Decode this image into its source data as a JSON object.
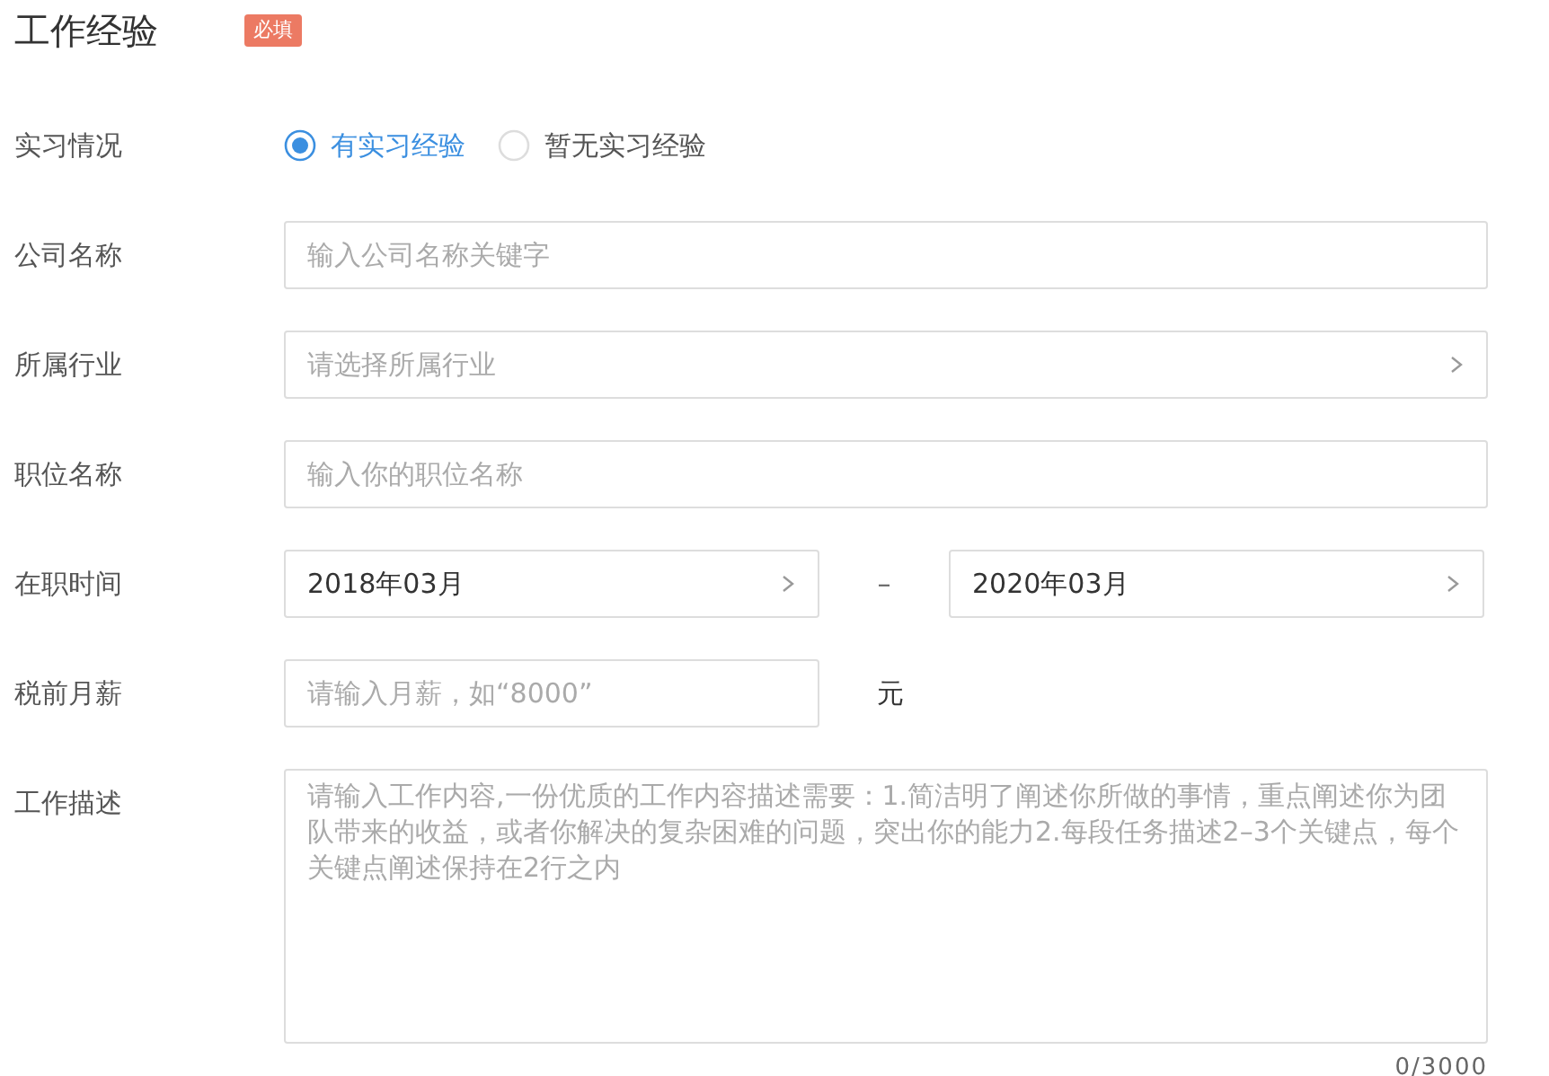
{
  "section": {
    "title": "工作经验",
    "badge": "必填"
  },
  "fields": [
    {
      "kind": "radio",
      "label": "实习情况",
      "options": [
        {
          "label": "有实习经验",
          "selected": true
        },
        {
          "label": "暂无实习经验",
          "selected": false
        }
      ]
    },
    {
      "kind": "text",
      "label": "公司名称",
      "placeholder": "输入公司名称关键字"
    },
    {
      "kind": "select",
      "label": "所属行业",
      "placeholder": "请选择所属行业"
    },
    {
      "kind": "text",
      "label": "职位名称",
      "placeholder": "输入你的职位名称"
    },
    {
      "kind": "range",
      "label": "在职时间",
      "start": "2018年03月",
      "separator": "–",
      "end": "2020年03月"
    },
    {
      "kind": "salary",
      "label": "税前月薪",
      "placeholder": "请输入月薪，如“8000”",
      "unit": "元"
    },
    {
      "kind": "textarea",
      "label": "工作描述",
      "placeholder": "请输入工作内容,一份优质的工作内容描述需要：1.简洁明了阐述你所做的事情，重点阐述你为团队带来的收益，或者你解决的复杂困难的问题，突出你的能力2.每段任务描述2–3个关键点，每个关键点阐述保持在2行之内",
      "counter": "0/3000"
    }
  ]
}
